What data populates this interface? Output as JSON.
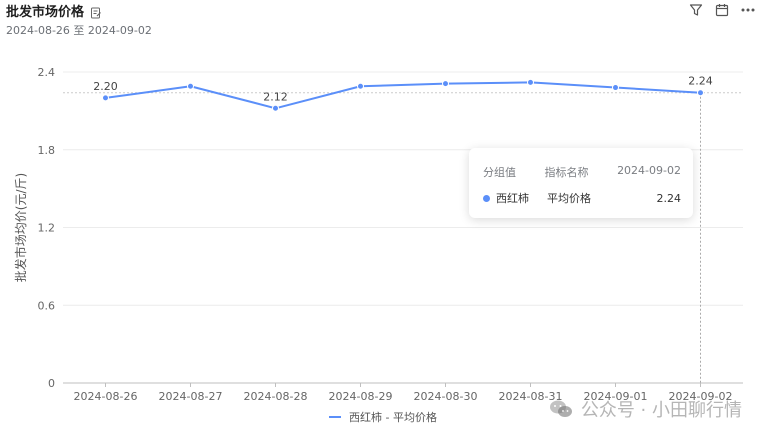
{
  "header": {
    "title": "批发市场价格",
    "subtitle": "2024-08-26 至 2024-09-02"
  },
  "toolbar": {
    "icons": [
      "filter-icon",
      "calendar-icon",
      "more-icon"
    ]
  },
  "colors": {
    "series": "#5b8ff9",
    "grid": "#ececec",
    "axis_text": "#666666"
  },
  "tooltip": {
    "head_group": "分组值",
    "head_metric": "指标名称",
    "head_date": "2024-09-02",
    "series_name": "西红柿",
    "metric_name": "平均价格",
    "value": "2.24"
  },
  "legend": {
    "label": "西红柿 - 平均价格"
  },
  "watermark": {
    "text": "公众号 · 小田聊行情"
  },
  "chart_data": {
    "type": "line",
    "ylabel": "批发市场均价(元/斤)",
    "ylim": [
      0,
      2.4
    ],
    "yticks": [
      "0",
      "0.6",
      "1.2",
      "1.8",
      "2.4"
    ],
    "ytick_values": [
      0,
      0.6,
      1.2,
      1.8,
      2.4
    ],
    "categories": [
      "2024-08-26",
      "2024-08-27",
      "2024-08-28",
      "2024-08-29",
      "2024-08-30",
      "2024-08-31",
      "2024-09-01",
      "2024-09-02"
    ],
    "series": [
      {
        "name": "西红柿 - 平均价格",
        "values": [
          2.2,
          2.29,
          2.12,
          2.29,
          2.31,
          2.32,
          2.28,
          2.24
        ]
      }
    ],
    "data_labels": [
      {
        "index": 0,
        "text": "2.20"
      },
      {
        "index": 2,
        "text": "2.12"
      },
      {
        "index": 7,
        "text": "2.24"
      }
    ],
    "highlight_index": 7,
    "grid": true,
    "legend_position": "bottom"
  }
}
